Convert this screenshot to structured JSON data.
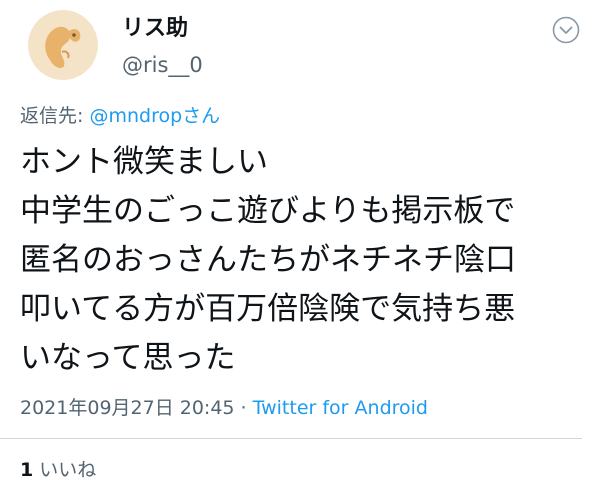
{
  "author": {
    "display_name": "リス助",
    "handle": "@ris__0",
    "avatar_icon": "squirrel-avatar-icon",
    "avatar_bg": "#f5e3c7",
    "avatar_fg": "#e9b26a"
  },
  "menu_icon": "chevron-down-icon",
  "reply": {
    "prefix": "返信先: ",
    "mention": "@mndropさん"
  },
  "body_lines": [
    "ホント微笑ましい",
    "中学生のごっこ遊びよりも掲示板で",
    "匿名のおっさんたちがネチネチ陰口",
    "叩いてる方が百万倍陰険で気持ち悪",
    "いなって思った"
  ],
  "meta": {
    "timestamp": "2021年09月27日 20:45",
    "separator": " · ",
    "source": "Twitter for Android"
  },
  "stats": {
    "likes_count": "1",
    "likes_label": "いいね"
  },
  "colors": {
    "text": "#0f1419",
    "secondary": "#536471",
    "link": "#1d9bf0"
  }
}
